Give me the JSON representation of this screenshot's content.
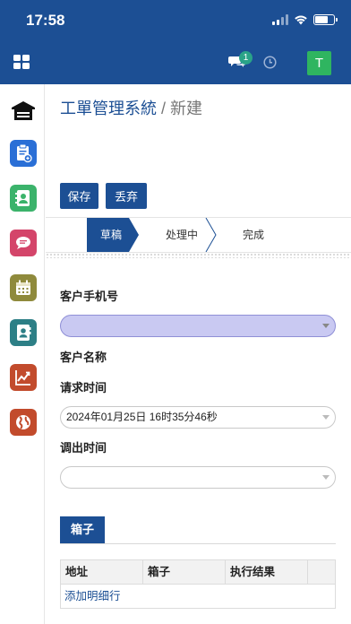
{
  "status_bar": {
    "time": "17:58"
  },
  "header": {
    "chat_badge_count": "1",
    "avatar_letter": "T",
    "colors": {
      "header_bg": "#1c4f94",
      "badge": "#2aa388",
      "avatar": "#2fb560"
    }
  },
  "sidebar": {
    "items": [
      {
        "icon": "warehouse-icon",
        "color": "#111111"
      },
      {
        "icon": "clipboard-icon",
        "color": "#2a6fd6"
      },
      {
        "icon": "contact-card-icon",
        "color": "#3bb36b"
      },
      {
        "icon": "chat-bubble-icon",
        "color": "#d4456a"
      },
      {
        "icon": "calendar-icon",
        "color": "#8f8a3c"
      },
      {
        "icon": "address-book-icon",
        "color": "#2d7f86"
      },
      {
        "icon": "chart-trend-icon",
        "color": "#c24b2c"
      },
      {
        "icon": "globe-icon",
        "color": "#c24b2c"
      }
    ]
  },
  "breadcrumb": {
    "root": "工單管理系統",
    "separator": "/",
    "current": "新建"
  },
  "toolbar": {
    "save_label": "保存",
    "discard_label": "丢弃"
  },
  "stages": {
    "items": [
      "草稿",
      "处理中",
      "完成"
    ],
    "active_index": 0
  },
  "form": {
    "phone_label": "客户手机号",
    "phone_value": "",
    "name_label": "客户名称",
    "request_time_label": "请求时间",
    "request_time_value": "2024年01月25日 16时35分46秒",
    "dispatch_time_label": "调出时间",
    "dispatch_time_value": ""
  },
  "tabs": {
    "box_tab": "箱子"
  },
  "table": {
    "columns": [
      "地址",
      "箱子",
      "执行结果",
      ""
    ],
    "add_row_label": "添加明细行"
  }
}
